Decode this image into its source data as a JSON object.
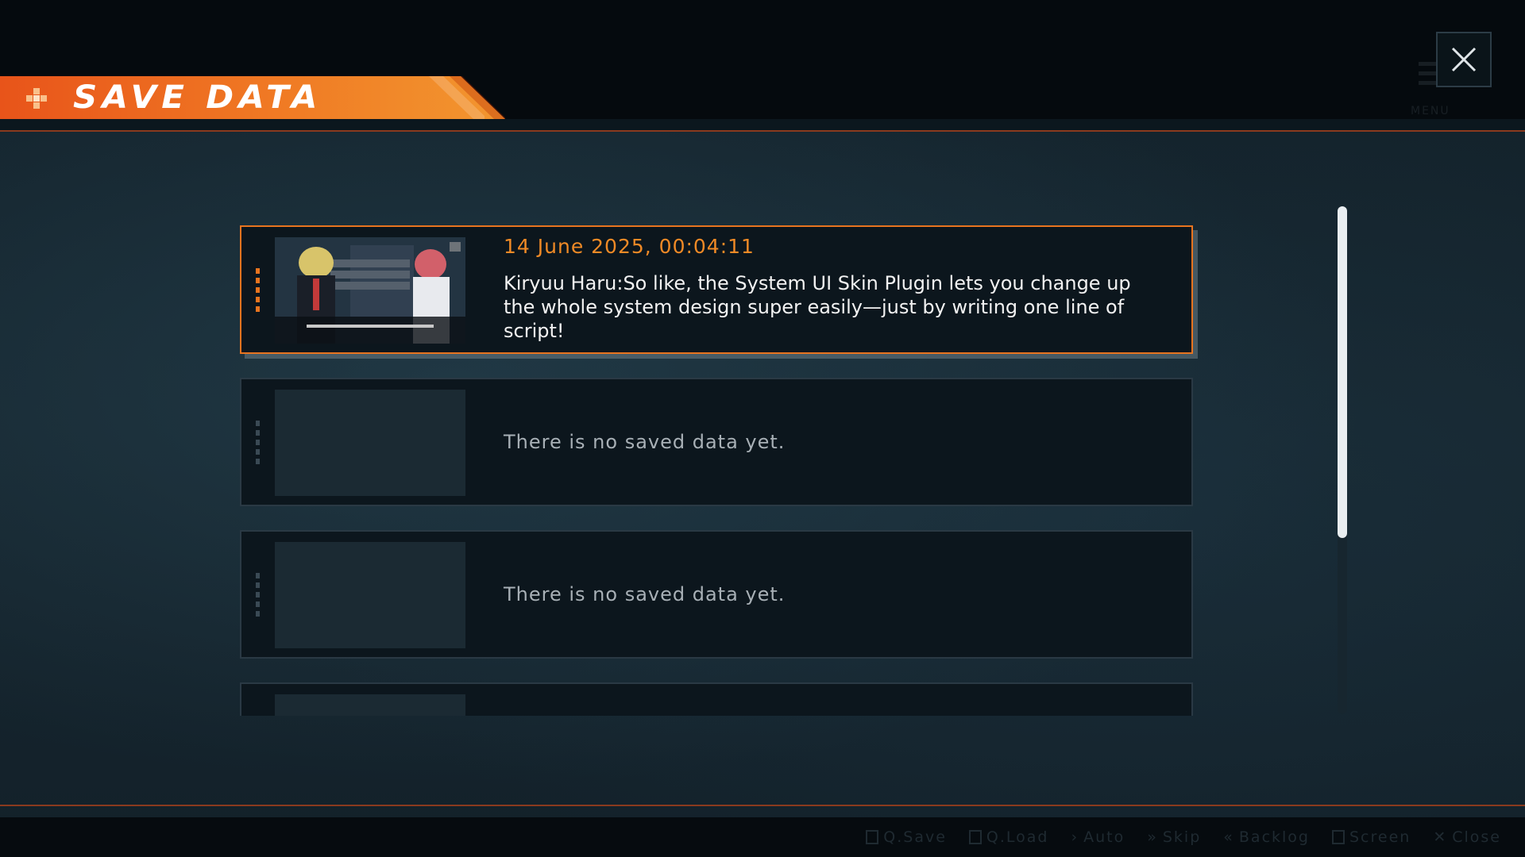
{
  "header": {
    "title": "SAVE DATA"
  },
  "menu": {
    "label": "MENU"
  },
  "slots": [
    {
      "date": "14 June 2025, 00:04:11",
      "text": "Kiryuu Haru:So like, the System UI Skin Plugin lets you change up the whole system design super easily—just by writing one line of script!"
    },
    {
      "empty_text": "There is no saved data yet."
    },
    {
      "empty_text": "There is no saved data yet."
    },
    {
      "empty_text": ""
    }
  ],
  "bottom_menu": [
    "Q.Save",
    "Q.Load",
    "Auto",
    "Skip",
    "Backlog",
    "Screen",
    "Close"
  ],
  "colors": {
    "accent": "#e8741f",
    "banner": "#f07a24",
    "panel": "#0c161d",
    "background": "#13222b"
  }
}
